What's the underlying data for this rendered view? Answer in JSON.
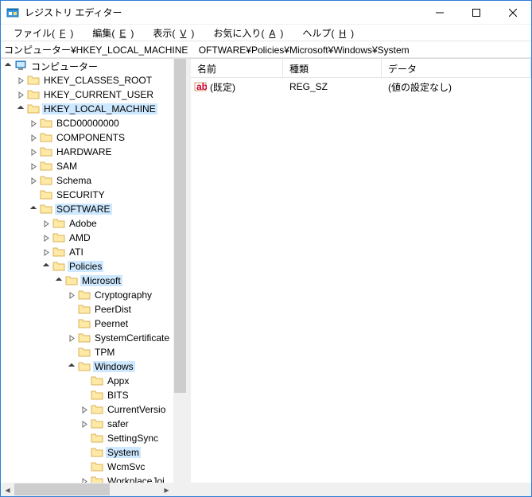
{
  "window": {
    "title": "レジストリ エディター"
  },
  "menu": {
    "file": "ファイル(",
    "file_u": "F",
    "file2": ")",
    "edit": "編集(",
    "edit_u": "E",
    "edit2": ")",
    "view": "表示(",
    "view_u": "V",
    "view2": ")",
    "fav": "お気に入り(",
    "fav_u": "A",
    "fav2": ")",
    "help": "ヘルプ(",
    "help_u": "H",
    "help2": ")"
  },
  "address": "コンピューター¥HKEY_LOCAL_MACHINE    OFTWARE¥Policies¥Microsoft¥Windows¥System",
  "columns": {
    "name": "名前",
    "type": "種類",
    "data": "データ"
  },
  "rows": [
    {
      "name": "(既定)",
      "type": "REG_SZ",
      "data": "(値の設定なし)"
    }
  ],
  "tree": {
    "root": "コンピューター",
    "hkcr": "HKEY_CLASSES_ROOT",
    "hkcu": "HKEY_CURRENT_USER",
    "hklm": "HKEY_LOCAL_MACHINE",
    "bcd": "BCD00000000",
    "components": "COMPONENTS",
    "hardware": "HARDWARE",
    "sam": "SAM",
    "schema": "Schema",
    "security": "SECURITY",
    "software": "SOFTWARE",
    "adobe": "Adobe",
    "amd": "AMD",
    "ati": "ATI",
    "policies": "Policies",
    "microsoft": "Microsoft",
    "crypto": "Cryptography",
    "peerdist": "PeerDist",
    "peernet": "Peernet",
    "syscert": "SystemCertificate",
    "tpm": "TPM",
    "windows": "Windows",
    "appx": "Appx",
    "bits": "BITS",
    "curver": "CurrentVersio",
    "safer": "safer",
    "setsync": "SettingSync",
    "system": "System",
    "wcmsvc": "WcmSvc",
    "workplace": "WorkplaceJoi"
  }
}
